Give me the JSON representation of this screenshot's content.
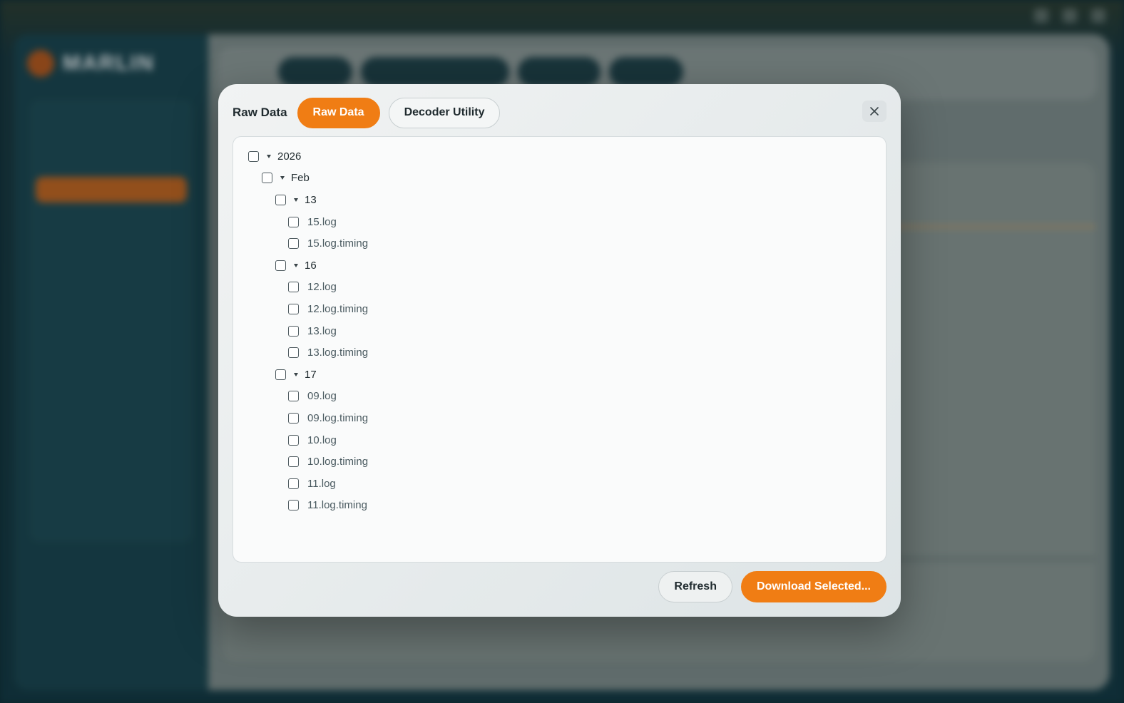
{
  "modal": {
    "title": "Raw Data",
    "tabs": [
      {
        "label": "Raw Data",
        "active": true
      },
      {
        "label": "Decoder Utility",
        "active": false
      }
    ],
    "close_icon": "close-icon",
    "tree": {
      "year": "2026",
      "month": "Feb",
      "days": [
        {
          "label": "13",
          "files": [
            "15.log",
            "15.log.timing"
          ]
        },
        {
          "label": "16",
          "files": [
            "12.log",
            "12.log.timing",
            "13.log",
            "13.log.timing"
          ]
        },
        {
          "label": "17",
          "files": [
            "09.log",
            "09.log.timing",
            "10.log",
            "10.log.timing",
            "11.log",
            "11.log.timing"
          ]
        }
      ]
    },
    "footer": {
      "refresh_label": "Refresh",
      "download_label": "Download Selected..."
    }
  },
  "colors": {
    "accent": "#f07d14",
    "sidebar": "#19424c"
  },
  "background": {
    "logo_text": "MARLIN"
  }
}
